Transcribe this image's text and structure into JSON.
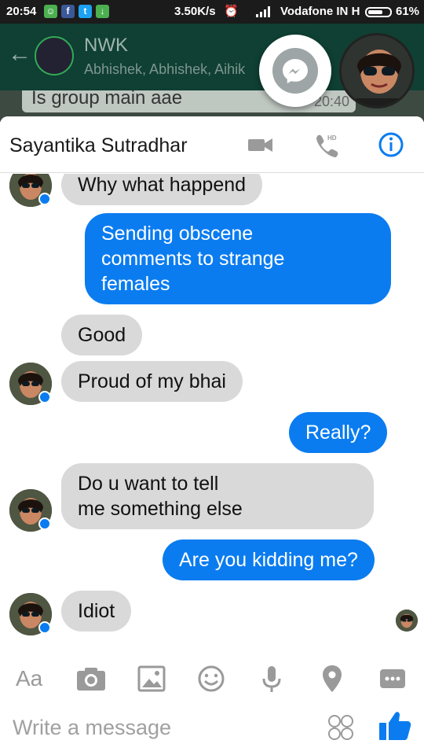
{
  "status_bar": {
    "time": "20:54",
    "speed": "3.50K/s",
    "carrier": "Vodafone IN",
    "network_type": "H",
    "battery": "61%"
  },
  "background_app": {
    "group_title": "NWK",
    "members": "Abhishek, Abhishek, Aihik",
    "last_message": "Is group main aae",
    "last_message_time": "20:40"
  },
  "chat_heads": {
    "app_icon": "messenger-icon",
    "user_icon": "avatar"
  },
  "conversation": {
    "contact_name": "Sayantika Sutradhar",
    "header_buttons": [
      "video-call-icon",
      "hd-voice-call-icon",
      "info-icon"
    ],
    "messages": [
      {
        "from": "them",
        "text": "Why what happend"
      },
      {
        "from": "me",
        "text": "Sending obscene\ncomments to strange\nfemales"
      },
      {
        "from": "them",
        "text": "Good"
      },
      {
        "from": "them",
        "text": "Proud of my bhai"
      },
      {
        "from": "me",
        "text": "Really?"
      },
      {
        "from": "them",
        "text": "Do u want to tell\nme something else"
      },
      {
        "from": "me",
        "text": "Are you kidding me?"
      },
      {
        "from": "them",
        "text": "Idiot"
      }
    ]
  },
  "composer": {
    "text_toggle": "Aa",
    "tools": [
      "camera-icon",
      "image-icon",
      "emoji-icon",
      "microphone-icon",
      "location-icon",
      "more-icon"
    ],
    "placeholder": "Write a message",
    "stickers_icon": "sticker-icon",
    "send_icon": "thumbs-up-icon"
  },
  "colors": {
    "accent": "#0a7cf0",
    "incoming_bubble": "#d9d9d9",
    "whatsapp_header": "#0f4033"
  }
}
